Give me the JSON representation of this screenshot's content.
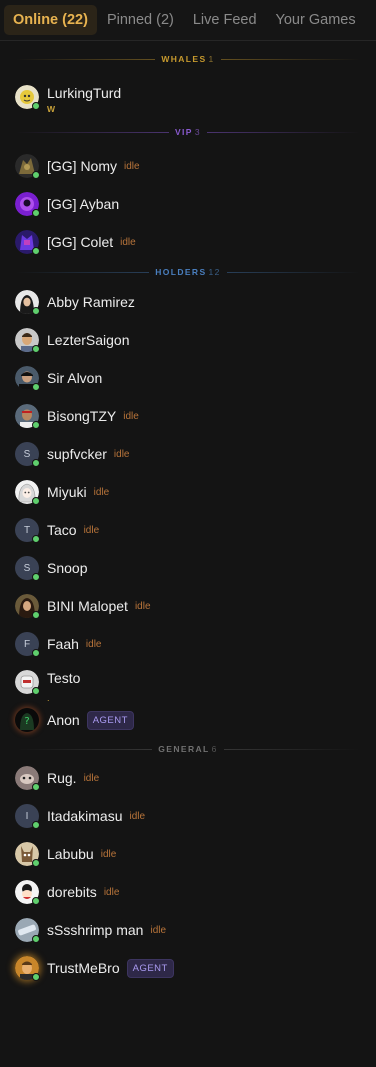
{
  "tabs": [
    {
      "label": "Online (22)"
    },
    {
      "label": "Pinned (2)"
    },
    {
      "label": "Live Feed"
    },
    {
      "label": "Your Games"
    }
  ],
  "colors": {
    "whales": "#c79a2e",
    "vip": "#7a4fbf",
    "holders": "#3f6fa6",
    "general": "#6a6a6a",
    "online_dot": "#5fcf6d",
    "idle": "#b8743a",
    "agent": "#a99af0"
  },
  "sections": {
    "whales": {
      "label": "WHALES",
      "count": "1"
    },
    "vip": {
      "label": "VIP",
      "count": "3"
    },
    "holders": {
      "label": "HOLDERS",
      "count": "12"
    },
    "general": {
      "label": "GENERAL",
      "count": "6"
    }
  },
  "idle_label": "idle",
  "agent_label": "AGENT",
  "users": {
    "lurkingturd": {
      "name": "LurkingTurd",
      "tag": "W"
    },
    "nomy": {
      "name": "[GG] Nomy"
    },
    "ayban": {
      "name": "[GG] Ayban"
    },
    "colet": {
      "name": "[GG] Colet"
    },
    "abby": {
      "name": "Abby Ramirez"
    },
    "lezter": {
      "name": "LezterSaigon"
    },
    "alvon": {
      "name": "Sir Alvon"
    },
    "bisong": {
      "name": "BisongTZY"
    },
    "supfvcker": {
      "name": "supfvcker",
      "initial": "S"
    },
    "miyuki": {
      "name": "Miyuki"
    },
    "taco": {
      "name": "Taco",
      "initial": "T"
    },
    "snoop": {
      "name": "Snoop",
      "initial": "S"
    },
    "bini": {
      "name": "BINI Malopet"
    },
    "faah": {
      "name": "Faah",
      "initial": "F"
    },
    "testo": {
      "name": "Testo",
      "tag": "."
    },
    "anon": {
      "name": "Anon"
    },
    "rug": {
      "name": "Rug."
    },
    "itadakimasu": {
      "name": "Itadakimasu",
      "initial": "I"
    },
    "labubu": {
      "name": "Labubu"
    },
    "dorebits": {
      "name": "dorebits"
    },
    "sssshrimp": {
      "name": "sSsshrimp man"
    },
    "trustmebro": {
      "name": "TrustMeBro"
    }
  }
}
